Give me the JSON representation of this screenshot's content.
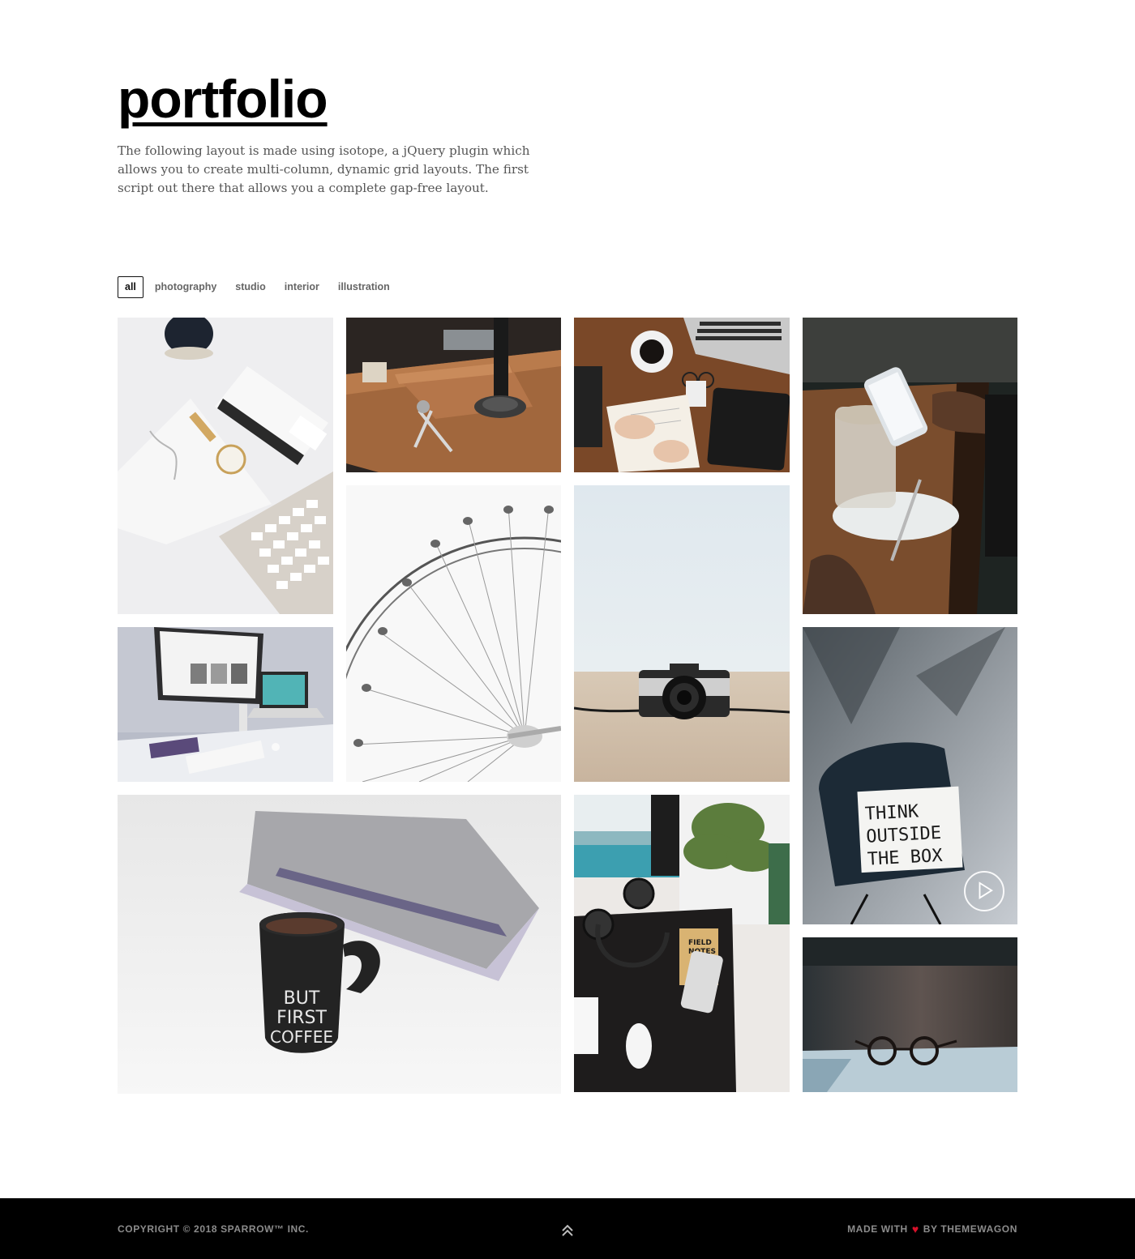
{
  "header": {
    "title": "portfolio",
    "intro": "The following layout is made using isotope, a jQuery plugin which allows you to create multi-column, dynamic grid layouts. The first script out there that allows you a complete gap-free layout."
  },
  "filters": [
    {
      "label": "all",
      "active": true
    },
    {
      "label": "photography",
      "active": false
    },
    {
      "label": "studio",
      "active": false
    },
    {
      "label": "interior",
      "active": false
    },
    {
      "label": "illustration",
      "active": false
    }
  ],
  "tiles": {
    "mug_text": [
      "BUT",
      "FIRST",
      "COFFEE"
    ],
    "sign_text": [
      "THINK",
      "OUTSIDE",
      "THE BOX"
    ],
    "notebook_text": [
      "FIELD",
      "NOTES"
    ],
    "play_icon": "play-circle-icon"
  },
  "footer": {
    "copyright": "COPYRIGHT © 2018 SPARROW™ INC.",
    "made_with": "MADE WITH",
    "heart": "♥",
    "by": "BY THEMEWAGON",
    "back_to_top_icon": "double-chevron-up-icon"
  },
  "colors": {
    "footer_bg": "#000000",
    "heart": "#d8112a",
    "active_filter_border": "#111111"
  }
}
